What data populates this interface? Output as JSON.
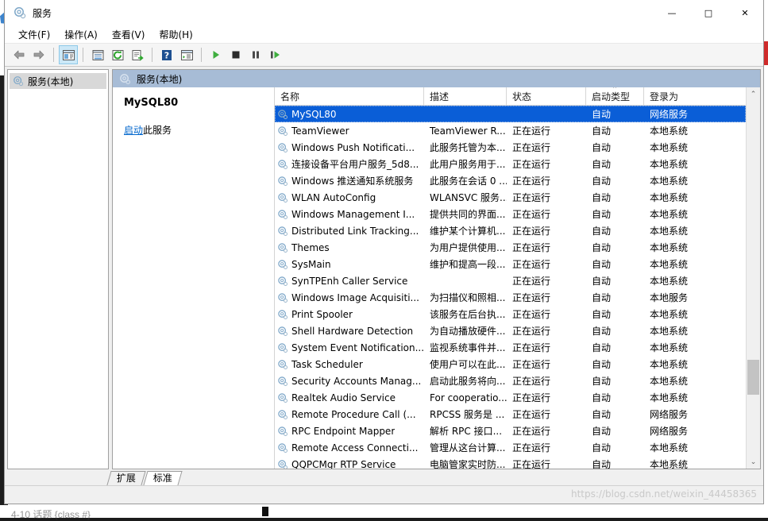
{
  "window": {
    "title": "服务",
    "icon": "services-gear-icon",
    "minimize": "—",
    "maximize": "□",
    "close": "✕"
  },
  "menubar": [
    {
      "label": "文件(F)",
      "name": "menu-file"
    },
    {
      "label": "操作(A)",
      "name": "menu-action"
    },
    {
      "label": "查看(V)",
      "name": "menu-view"
    },
    {
      "label": "帮助(H)",
      "name": "menu-help"
    }
  ],
  "toolbar": [
    {
      "name": "back-button",
      "icon": "arrow-left-icon",
      "pressed": false
    },
    {
      "name": "forward-button",
      "icon": "arrow-right-icon",
      "pressed": false
    },
    {
      "name": "show-console-tree-button",
      "icon": "console-tree-icon",
      "pressed": true
    },
    {
      "name": "properties-button",
      "icon": "properties-icon",
      "pressed": false
    },
    {
      "name": "refresh-button",
      "icon": "refresh-icon",
      "pressed": false
    },
    {
      "name": "export-list-button",
      "icon": "export-list-icon",
      "pressed": false
    },
    {
      "name": "help-button",
      "icon": "help-question-icon",
      "pressed": false
    },
    {
      "name": "show-action-pane-button",
      "icon": "action-pane-icon",
      "pressed": false
    },
    {
      "name": "start-service-button",
      "icon": "play-icon",
      "pressed": false
    },
    {
      "name": "stop-service-button",
      "icon": "stop-icon",
      "pressed": false
    },
    {
      "name": "pause-service-button",
      "icon": "pause-icon",
      "pressed": false
    },
    {
      "name": "restart-service-button",
      "icon": "restart-icon",
      "pressed": false
    }
  ],
  "tree": {
    "root_label": "服务(本地)",
    "root_icon": "services-gear-icon"
  },
  "pane_header": {
    "label": "服务(本地)",
    "icon": "services-gear-icon"
  },
  "detail": {
    "service_name": "MySQL80",
    "action_link": "启动",
    "action_suffix": "此服务"
  },
  "columns": [
    {
      "label": "名称",
      "name": "column-header-name",
      "sorted": false
    },
    {
      "label": "描述",
      "name": "column-header-description",
      "sorted": false
    },
    {
      "label": "状态",
      "name": "column-header-status",
      "sorted": false
    },
    {
      "label": "启动类型",
      "name": "column-header-startup-type",
      "sorted": true,
      "sort_arrow": "⌃"
    },
    {
      "label": "登录为",
      "name": "column-header-log-on-as",
      "sorted": false
    }
  ],
  "rows": [
    {
      "name": "MySQL80",
      "desc": "",
      "status": "",
      "startup": "自动",
      "logon": "网络服务",
      "selected": true
    },
    {
      "name": "TeamViewer",
      "desc": "TeamViewer R...",
      "status": "正在运行",
      "startup": "自动",
      "logon": "本地系统",
      "selected": false
    },
    {
      "name": "Windows Push Notificati...",
      "desc": "此服务托管为本...",
      "status": "正在运行",
      "startup": "自动",
      "logon": "本地系统",
      "selected": false
    },
    {
      "name": "连接设备平台用户服务_5d8...",
      "desc": "此用户服务用于...",
      "status": "正在运行",
      "startup": "自动",
      "logon": "本地系统",
      "selected": false
    },
    {
      "name": "Windows 推送通知系统服务",
      "desc": "此服务在会话 0 ...",
      "status": "正在运行",
      "startup": "自动",
      "logon": "本地系统",
      "selected": false
    },
    {
      "name": "WLAN AutoConfig",
      "desc": "WLANSVC 服务...",
      "status": "正在运行",
      "startup": "自动",
      "logon": "本地系统",
      "selected": false
    },
    {
      "name": "Windows Management I...",
      "desc": "提供共同的界面...",
      "status": "正在运行",
      "startup": "自动",
      "logon": "本地系统",
      "selected": false
    },
    {
      "name": "Distributed Link Tracking...",
      "desc": "维护某个计算机...",
      "status": "正在运行",
      "startup": "自动",
      "logon": "本地系统",
      "selected": false
    },
    {
      "name": "Themes",
      "desc": "为用户提供使用...",
      "status": "正在运行",
      "startup": "自动",
      "logon": "本地系统",
      "selected": false
    },
    {
      "name": "SysMain",
      "desc": "维护和提高一段...",
      "status": "正在运行",
      "startup": "自动",
      "logon": "本地系统",
      "selected": false
    },
    {
      "name": "SynTPEnh Caller Service",
      "desc": "",
      "status": "正在运行",
      "startup": "自动",
      "logon": "本地系统",
      "selected": false
    },
    {
      "name": "Windows Image Acquisiti...",
      "desc": "为扫描仪和照相...",
      "status": "正在运行",
      "startup": "自动",
      "logon": "本地服务",
      "selected": false
    },
    {
      "name": "Print Spooler",
      "desc": "该服务在后台执...",
      "status": "正在运行",
      "startup": "自动",
      "logon": "本地系统",
      "selected": false
    },
    {
      "name": "Shell Hardware Detection",
      "desc": "为自动播放硬件...",
      "status": "正在运行",
      "startup": "自动",
      "logon": "本地系统",
      "selected": false
    },
    {
      "name": "System Event Notification...",
      "desc": "监视系统事件并...",
      "status": "正在运行",
      "startup": "自动",
      "logon": "本地系统",
      "selected": false
    },
    {
      "name": "Task Scheduler",
      "desc": "使用户可以在此...",
      "status": "正在运行",
      "startup": "自动",
      "logon": "本地系统",
      "selected": false
    },
    {
      "name": "Security Accounts Manag...",
      "desc": "启动此服务将向...",
      "status": "正在运行",
      "startup": "自动",
      "logon": "本地系统",
      "selected": false
    },
    {
      "name": "Realtek Audio Service",
      "desc": "For cooperatio...",
      "status": "正在运行",
      "startup": "自动",
      "logon": "本地系统",
      "selected": false
    },
    {
      "name": "Remote Procedure Call (...",
      "desc": "RPCSS 服务是 ...",
      "status": "正在运行",
      "startup": "自动",
      "logon": "网络服务",
      "selected": false
    },
    {
      "name": "RPC Endpoint Mapper",
      "desc": "解析 RPC 接口...",
      "status": "正在运行",
      "startup": "自动",
      "logon": "网络服务",
      "selected": false
    },
    {
      "name": "Remote Access Connecti...",
      "desc": "管理从这台计算...",
      "status": "正在运行",
      "startup": "自动",
      "logon": "本地系统",
      "selected": false
    },
    {
      "name": "QQPCMgr RTP Service",
      "desc": "电脑管家实时防...",
      "status": "正在运行",
      "startup": "自动",
      "logon": "本地系统",
      "selected": false
    }
  ],
  "scrollbar": {
    "up_arrow": "⌃",
    "down_arrow": "⌄",
    "thumb_top_percent": 73,
    "thumb_height_percent": 10
  },
  "tabs": [
    {
      "label": "扩展",
      "name": "tab-extended",
      "active": false
    },
    {
      "label": "标准",
      "name": "tab-standard",
      "active": true
    }
  ],
  "watermark": "https://blog.csdn.net/weixin_44458365",
  "background": {
    "behind_text": "4-10 话题  {class #}"
  },
  "colors": {
    "selection": "#0a5ed7",
    "pane_header": "#a7bcd6",
    "link": "#0066cc",
    "toolbar_pressed": "#cce8f7"
  }
}
